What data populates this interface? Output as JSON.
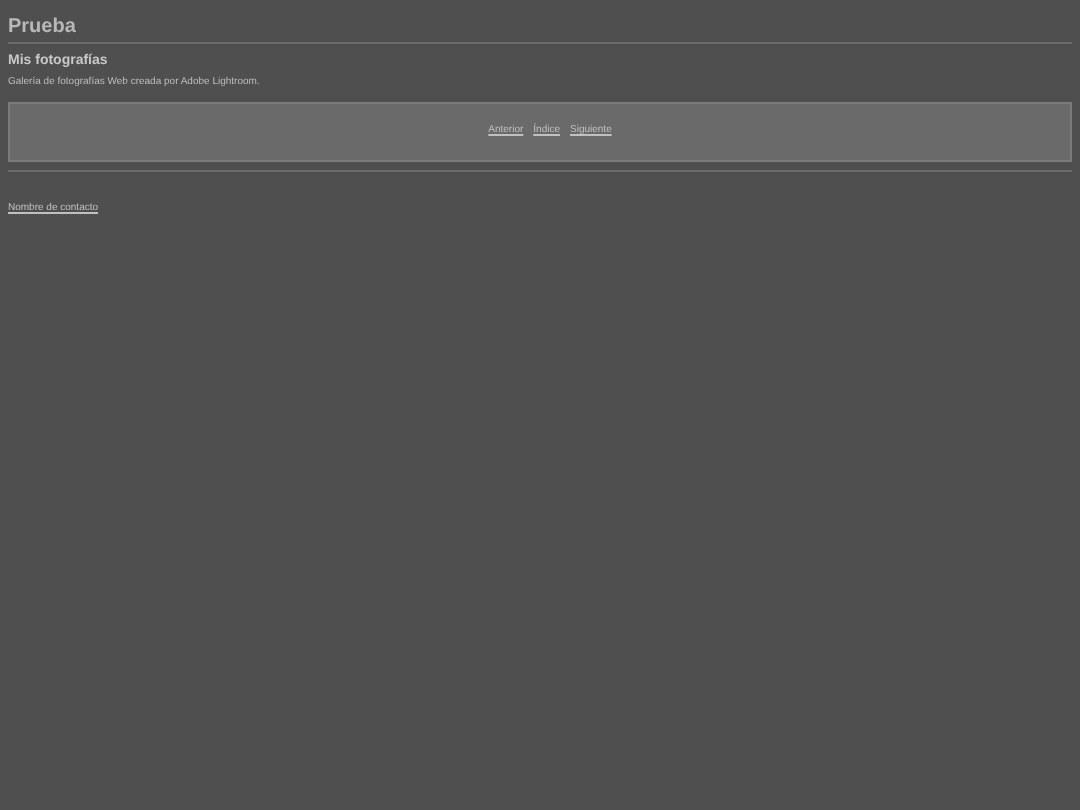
{
  "site_title": "Prueba",
  "gallery": {
    "title": "Mis fotografías",
    "description": "Galería de fotografías Web creada por Adobe Lightroom."
  },
  "nav": [
    {
      "label": "Anterior"
    },
    {
      "label": "Índice"
    },
    {
      "label": "Siguiente"
    }
  ],
  "contact_link": "Nombre de contacto"
}
